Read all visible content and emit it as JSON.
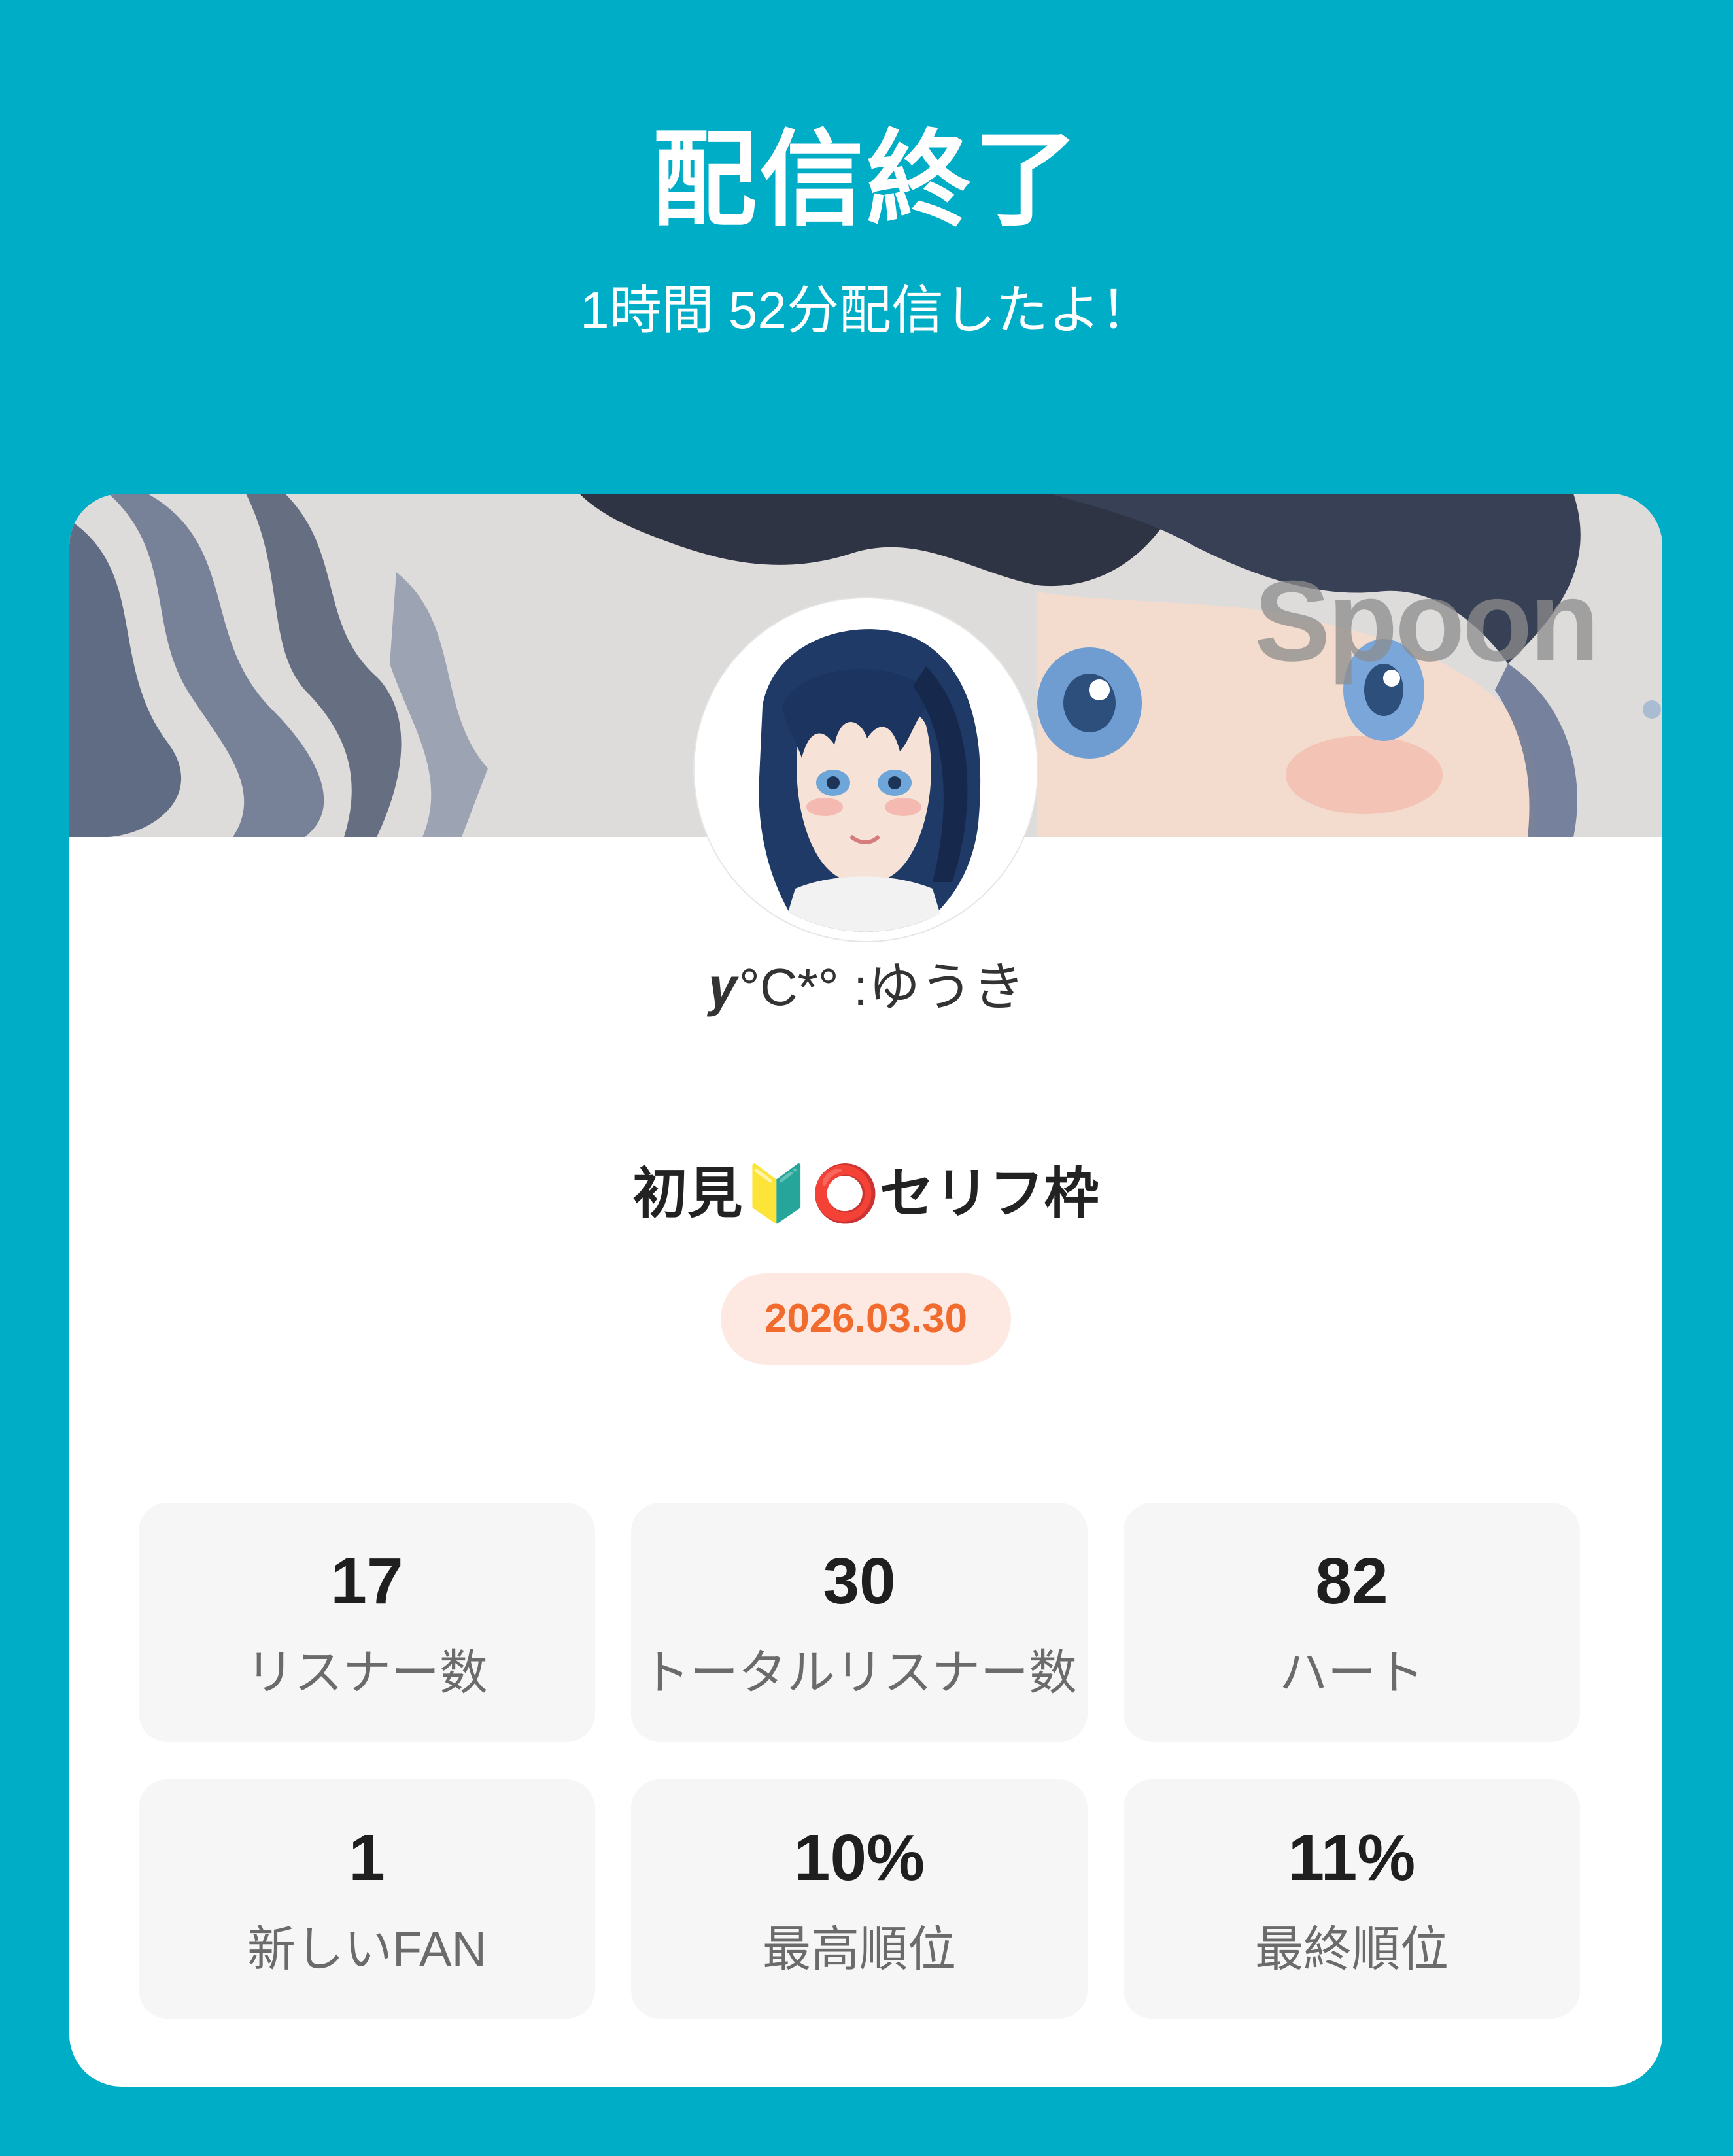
{
  "header": {
    "title": "配信終了",
    "subtitle": "1時間 52分配信したよ！"
  },
  "card": {
    "watermark": "Spoon",
    "username": "𝒚°C*° :ゆうき",
    "live_title": "初見🔰⭕セリフ枠",
    "date": "2026.03.30"
  },
  "stats": [
    {
      "value": "17",
      "label": "リスナー数"
    },
    {
      "value": "30",
      "label": "トータルリスナー数"
    },
    {
      "value": "82",
      "label": "ハート"
    },
    {
      "value": "1",
      "label": "新しいFAN"
    },
    {
      "value": "10%",
      "label": "最高順位"
    },
    {
      "value": "11%",
      "label": "最終順位"
    }
  ],
  "colors": {
    "background": "#00adc6",
    "card": "#ffffff",
    "tile": "#f6f6f6",
    "date_badge_bg": "#fde9e2",
    "date_badge_text": "#f26b2e"
  }
}
